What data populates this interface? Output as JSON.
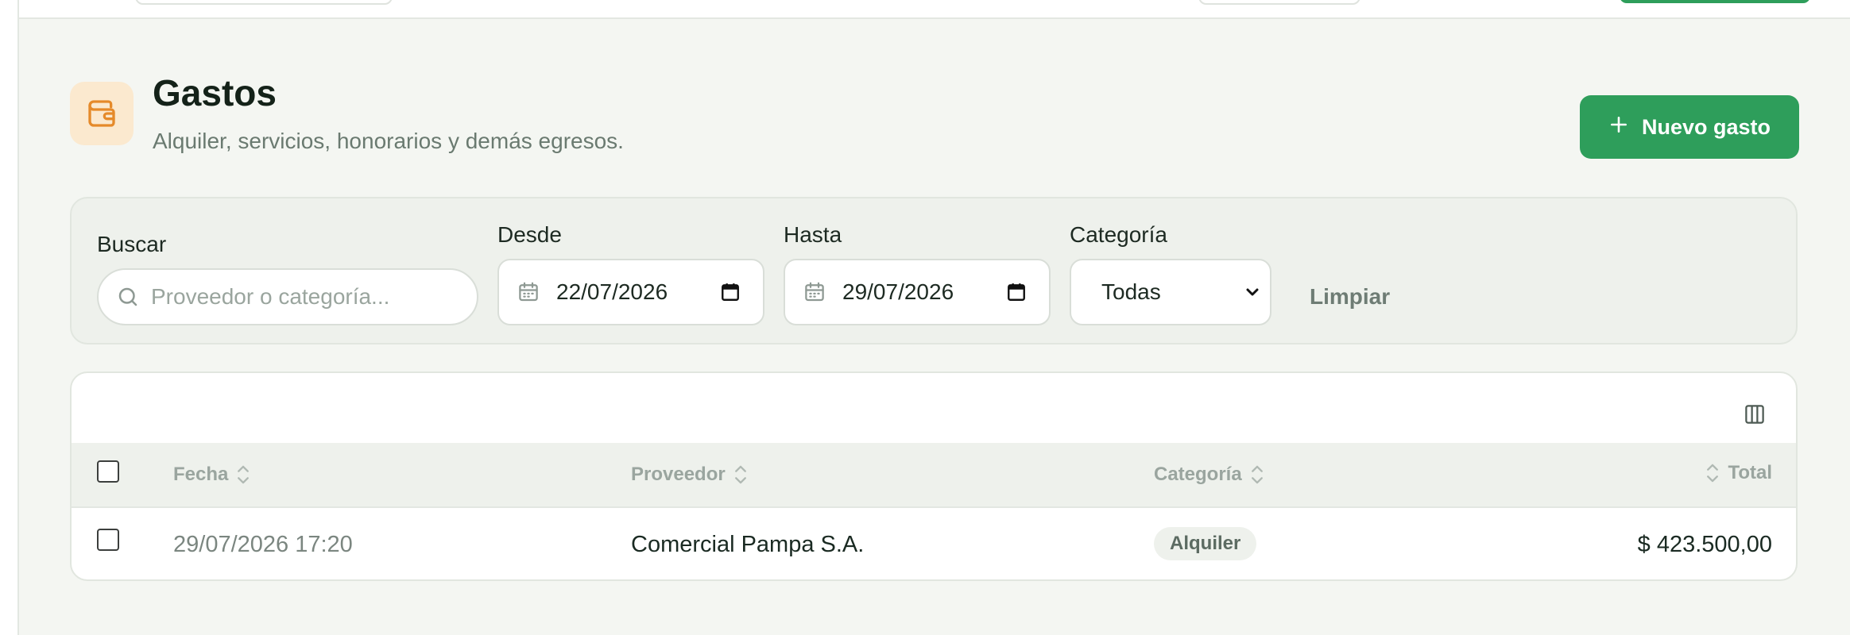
{
  "header": {
    "title": "Gastos",
    "subtitle": "Alquiler, servicios, honorarios y demás egresos.",
    "icon": "wallet-icon",
    "new_button_label": "Nuevo gasto"
  },
  "filters": {
    "search": {
      "label": "Buscar",
      "placeholder": "Proveedor o categoría..."
    },
    "from": {
      "label": "Desde",
      "value": "22/07/2026"
    },
    "to": {
      "label": "Hasta",
      "value": "29/07/2026"
    },
    "category": {
      "label": "Categoría",
      "selected": "Todas"
    },
    "clear_label": "Limpiar"
  },
  "table": {
    "columns": [
      "Fecha",
      "Proveedor",
      "Categoría",
      "Total"
    ],
    "rows": [
      {
        "date": "29/07/2026 17:20",
        "provider": "Comercial Pampa S.A.",
        "category": "Alquiler",
        "total": "$ 423.500,00"
      }
    ]
  },
  "colors": {
    "accent": "#2e9e5b",
    "icon_bg": "#fbe9cf",
    "icon_fg": "#e58a2a",
    "background": "#f4f6f2"
  }
}
